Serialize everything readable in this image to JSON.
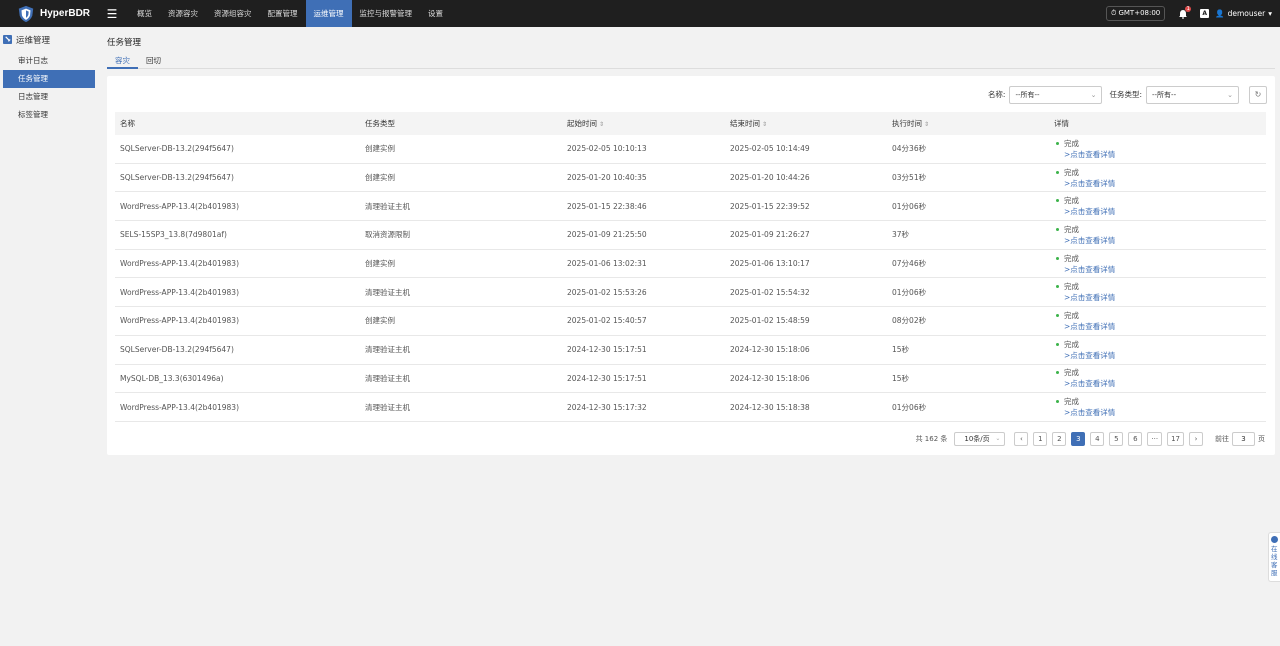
{
  "app": {
    "name": "HyperBDR",
    "brand_color": "#3f6fb6"
  },
  "nav": {
    "items": [
      {
        "label": "概览"
      },
      {
        "label": "资源容灾"
      },
      {
        "label": "资源组容灾"
      },
      {
        "label": "配置管理"
      },
      {
        "label": "运维管理",
        "active": true
      },
      {
        "label": "监控与报警管理"
      },
      {
        "label": "设置"
      }
    ]
  },
  "topright": {
    "timezone": "GMT+08:00",
    "bell_badge": "1",
    "user": "demouser"
  },
  "sidebar": {
    "title": "运维管理",
    "items": [
      {
        "label": "审计日志"
      },
      {
        "label": "任务管理",
        "active": true
      },
      {
        "label": "日志管理"
      },
      {
        "label": "标签管理"
      }
    ]
  },
  "page": {
    "title": "任务管理"
  },
  "tabs": [
    {
      "label": "容灾",
      "active": true
    },
    {
      "label": "回切"
    }
  ],
  "filters": {
    "name_label": "名称:",
    "name_value": "--所有--",
    "type_label": "任务类型:",
    "type_value": "--所有--"
  },
  "table": {
    "headers": [
      "名称",
      "任务类型",
      "起始时间",
      "结束时间",
      "执行时间",
      "详情"
    ],
    "rows": [
      {
        "name": "SQLServer-DB-13.2(294f5647)",
        "type": "创建实例",
        "start": "2025-02-05 10:10:13",
        "end": "2025-02-05 10:14:49",
        "duration": "04分36秒",
        "status": "完成",
        "link": ">点击查看详情"
      },
      {
        "name": "SQLServer-DB-13.2(294f5647)",
        "type": "创建实例",
        "start": "2025-01-20 10:40:35",
        "end": "2025-01-20 10:44:26",
        "duration": "03分51秒",
        "status": "完成",
        "link": ">点击查看详情"
      },
      {
        "name": "WordPress-APP-13.4(2b401983)",
        "type": "清理验证主机",
        "start": "2025-01-15 22:38:46",
        "end": "2025-01-15 22:39:52",
        "duration": "01分06秒",
        "status": "完成",
        "link": ">点击查看详情"
      },
      {
        "name": "SELS-15SP3_13.8(7d9801af)",
        "type": "取消资源限制",
        "start": "2025-01-09 21:25:50",
        "end": "2025-01-09 21:26:27",
        "duration": "37秒",
        "status": "完成",
        "link": ">点击查看详情"
      },
      {
        "name": "WordPress-APP-13.4(2b401983)",
        "type": "创建实例",
        "start": "2025-01-06 13:02:31",
        "end": "2025-01-06 13:10:17",
        "duration": "07分46秒",
        "status": "完成",
        "link": ">点击查看详情"
      },
      {
        "name": "WordPress-APP-13.4(2b401983)",
        "type": "清理验证主机",
        "start": "2025-01-02 15:53:26",
        "end": "2025-01-02 15:54:32",
        "duration": "01分06秒",
        "status": "完成",
        "link": ">点击查看详情"
      },
      {
        "name": "WordPress-APP-13.4(2b401983)",
        "type": "创建实例",
        "start": "2025-01-02 15:40:57",
        "end": "2025-01-02 15:48:59",
        "duration": "08分02秒",
        "status": "完成",
        "link": ">点击查看详情"
      },
      {
        "name": "SQLServer-DB-13.2(294f5647)",
        "type": "清理验证主机",
        "start": "2024-12-30 15:17:51",
        "end": "2024-12-30 15:18:06",
        "duration": "15秒",
        "status": "完成",
        "link": ">点击查看详情"
      },
      {
        "name": "MySQL-DB_13.3(6301496a)",
        "type": "清理验证主机",
        "start": "2024-12-30 15:17:51",
        "end": "2024-12-30 15:18:06",
        "duration": "15秒",
        "status": "完成",
        "link": ">点击查看详情"
      },
      {
        "name": "WordPress-APP-13.4(2b401983)",
        "type": "清理验证主机",
        "start": "2024-12-30 15:17:32",
        "end": "2024-12-30 15:18:38",
        "duration": "01分06秒",
        "status": "完成",
        "link": ">点击查看详情"
      }
    ]
  },
  "pagination": {
    "total": "共 162 条",
    "page_size": "10条/页",
    "pages": [
      "1",
      "2",
      "3",
      "4",
      "5",
      "6",
      "···",
      "17"
    ],
    "current": "3",
    "goto_label": "前往",
    "goto_value": "3",
    "goto_unit": "页"
  },
  "support": {
    "label": "在线客服"
  }
}
